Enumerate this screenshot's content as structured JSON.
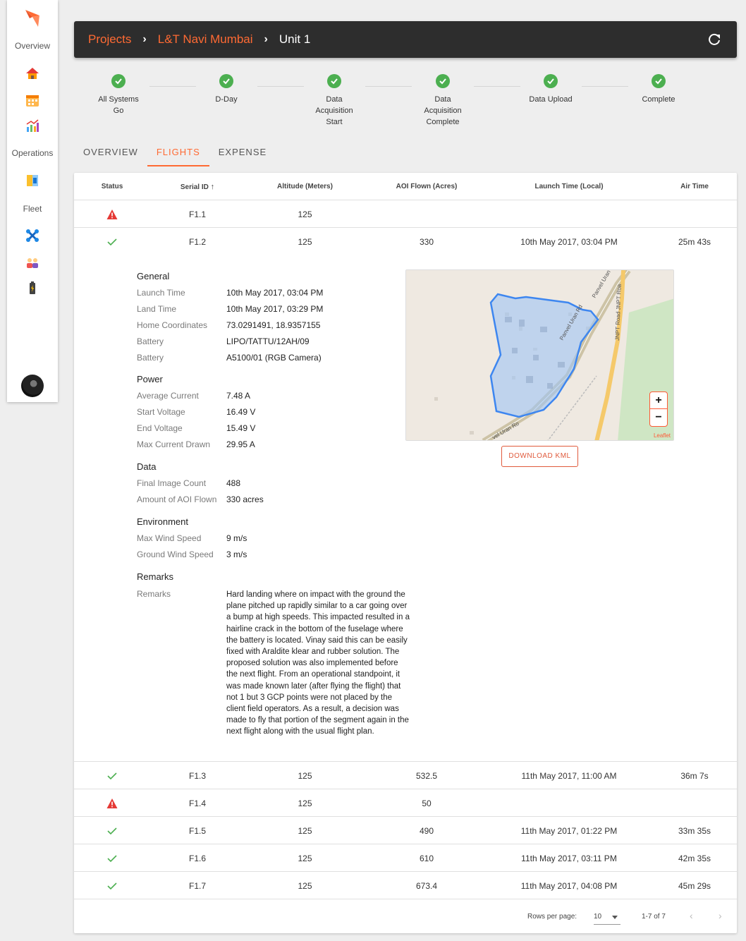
{
  "sidebar": {
    "overview_label": "Overview",
    "operations_label": "Operations",
    "fleet_label": "Fleet"
  },
  "breadcrumb": [
    "Projects",
    "L&T Navi Mumbai",
    "Unit 1"
  ],
  "steps": [
    "All Systems\nGo",
    "D-Day",
    "Data\nAcquisition\nStart",
    "Data\nAcquisition\nComplete",
    "Data Upload",
    "Complete"
  ],
  "tabs": [
    "OVERVIEW",
    "FLIGHTS",
    "EXPENSE"
  ],
  "active_tab": "FLIGHTS",
  "table": {
    "headers": {
      "status": "Status",
      "serial": "Serial ID",
      "altitude": "Altitude (Meters)",
      "aoi": "AOI Flown (Acres)",
      "launch": "Launch Time (Local)",
      "air": "Air Time"
    },
    "rows": [
      {
        "status": "warning",
        "serial": "F1.1",
        "altitude": "125",
        "aoi": "",
        "launch": "",
        "air": ""
      },
      {
        "status": "ok",
        "serial": "F1.2",
        "altitude": "125",
        "aoi": "330",
        "launch": "10th May 2017, 03:04 PM",
        "air": "25m 43s"
      },
      {
        "status": "ok",
        "serial": "F1.3",
        "altitude": "125",
        "aoi": "532.5",
        "launch": "11th May 2017, 11:00 AM",
        "air": "36m 7s"
      },
      {
        "status": "warning",
        "serial": "F1.4",
        "altitude": "125",
        "aoi": "50",
        "launch": "",
        "air": ""
      },
      {
        "status": "ok",
        "serial": "F1.5",
        "altitude": "125",
        "aoi": "490",
        "launch": "11th May 2017, 01:22 PM",
        "air": "33m 35s"
      },
      {
        "status": "ok",
        "serial": "F1.6",
        "altitude": "125",
        "aoi": "610",
        "launch": "11th May 2017, 03:11 PM",
        "air": "42m 35s"
      },
      {
        "status": "ok",
        "serial": "F1.7",
        "altitude": "125",
        "aoi": "673.4",
        "launch": "11th May 2017, 04:08 PM",
        "air": "45m 29s"
      }
    ]
  },
  "detail": {
    "general": {
      "title": "General",
      "items": [
        {
          "k": "Launch Time",
          "v": "10th May 2017, 03:04 PM"
        },
        {
          "k": "Land Time",
          "v": "10th May 2017, 03:29 PM"
        },
        {
          "k": "Home Coordinates",
          "v": "73.0291491, 18.9357155"
        },
        {
          "k": "Battery",
          "v": "LIPO/TATTU/12AH/09"
        },
        {
          "k": "Battery",
          "v": "A5100/01 (RGB Camera)"
        }
      ]
    },
    "power": {
      "title": "Power",
      "items": [
        {
          "k": "Average Current",
          "v": "7.48 A"
        },
        {
          "k": "Start Voltage",
          "v": "16.49 V"
        },
        {
          "k": "End Voltage",
          "v": "15.49 V"
        },
        {
          "k": "Max Current Drawn",
          "v": "29.95 A"
        }
      ]
    },
    "data": {
      "title": "Data",
      "items": [
        {
          "k": "Final Image Count",
          "v": "488"
        },
        {
          "k": "Amount of AOI Flown",
          "v": "330 acres"
        }
      ]
    },
    "environment": {
      "title": "Environment",
      "items": [
        {
          "k": "Max Wind Speed",
          "v": "9 m/s"
        },
        {
          "k": "Ground Wind Speed",
          "v": "3 m/s"
        }
      ]
    },
    "remarks": {
      "title": "Remarks",
      "label": "Remarks",
      "text": "Hard landing where on impact with the ground the plane pitched up rapidly similar to a car going over a bump at high speeds. This impacted resulted in a hairline crack in the bottom of the fuselage where the battery is located. Vinay said this can be easily fixed with Araldite klear and rubber solution. The proposed solution was also implemented before the next flight. From an operational standpoint, it was made known later (after flying the flight) that not 1 but 3 GCP points were not placed by the client field operators. As a result, a decision was made to fly that portion of the segment again in the next flight along with the usual flight plan."
    },
    "map": {
      "road_label_1": "Panvel Uran Rd",
      "road_label_2": "Panvel Uran Rd",
      "road_label_3": "JNPT Road JNPT Roa",
      "road_label_4": "vel Uran Ro",
      "zoom_in": "+",
      "zoom_out": "−",
      "attribution": "Leaflet"
    },
    "download_label": "DOWNLOAD KML"
  },
  "pagination": {
    "rows_per_page_label": "Rows per page:",
    "rows_per_page": "10",
    "range": "1-7 of 7",
    "prev": "‹",
    "next": "›"
  },
  "colors": {
    "accent": "#ff6a33",
    "success": "#4caf50",
    "warning": "#e53935",
    "header_bg": "#2d2d2d"
  }
}
